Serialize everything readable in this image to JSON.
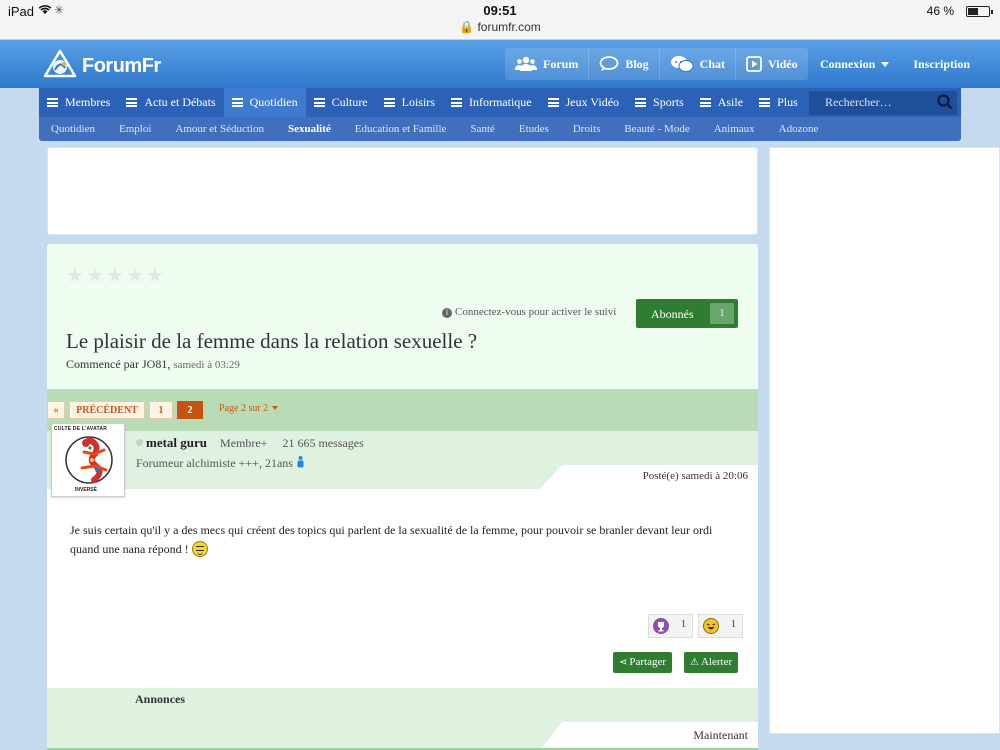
{
  "status_bar": {
    "device": "iPad",
    "time": "09:51",
    "url": "forumfr.com",
    "battery": "46 %"
  },
  "header": {
    "logo_text": "ForumFr",
    "nav": [
      {
        "label": "Forum",
        "icon": "users-icon"
      },
      {
        "label": "Blog",
        "icon": "speech-bubble-icon"
      },
      {
        "label": "Chat",
        "icon": "chat-icon"
      },
      {
        "label": "Vidéo",
        "icon": "play-icon"
      }
    ],
    "login": "Connexion",
    "register": "Inscription"
  },
  "categories": [
    "Membres",
    "Actu et Débats",
    "Quotidien",
    "Culture",
    "Loisirs",
    "Informatique",
    "Jeux Vidéo",
    "Sports",
    "Asile",
    "Plus"
  ],
  "active_category": "Quotidien",
  "search": {
    "placeholder": "Rechercher…"
  },
  "subcategories": [
    "Quotidien",
    "Emploi",
    "Amour et Séduction",
    "Sexualité",
    "Education et Famille",
    "Santé",
    "Etudes",
    "Droits",
    "Beauté - Mode",
    "Animaux",
    "Adozone"
  ],
  "active_subcategory": "Sexualité",
  "thread": {
    "rating_stars": 5,
    "rating_value": 0,
    "follow_hint": "Connectez-vous pour activer le suivi",
    "follow_label": "Abonnés",
    "follow_count": "1",
    "title": "Le plaisir de la femme dans la relation sexuelle ?",
    "started_by_prefix": "Commencé par",
    "started_by": "JO81",
    "started_date": "samedi à 03:29"
  },
  "pager": {
    "prev_icon": "«",
    "prev_label": "PRÉCÉDENT",
    "pages": [
      "1",
      "2"
    ],
    "current_page": "2",
    "info": "Page 2 sur 2"
  },
  "post": {
    "avatar_top": "CULTE DE L'AVATAR",
    "avatar_bottom": "INVERSÉ",
    "author": "metal guru",
    "rank": "Membre+",
    "messages": "21 665 messages",
    "title_line": "Forumeur alchimiste +++, 21ans",
    "posted": "Posté(e) samedi à 20:06",
    "body": "Je suis certain qu'il y a des mecs qui créent des topics qui parlent de la sexualité de la femme, pour pouvoir se branler devant leur ordi quand une nana répond !",
    "reactions": [
      {
        "icon": "trophy-icon",
        "count": "1",
        "color": "#8e4fb0"
      },
      {
        "icon": "laugh-icon",
        "count": "1",
        "color": "#f2c230"
      }
    ],
    "share_label": "Partager",
    "alert_label": "Alerter"
  },
  "announce": {
    "title": "Annonces",
    "time": "Maintenant"
  },
  "colors": {
    "header_blue": "#2f78cd",
    "category_blue": "#2b62b8",
    "button_green": "#2e7d32",
    "pager_orange": "#c55411",
    "light_green": "#dff2e0"
  }
}
